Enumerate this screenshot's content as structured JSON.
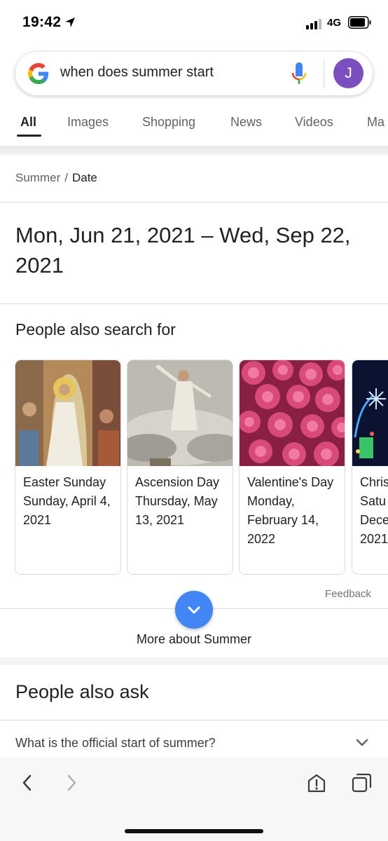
{
  "status_bar": {
    "time": "19:42",
    "network": "4G"
  },
  "search": {
    "query": "when does summer start",
    "avatar_letter": "J"
  },
  "tabs": [
    {
      "label": "All"
    },
    {
      "label": "Images"
    },
    {
      "label": "Shopping"
    },
    {
      "label": "News"
    },
    {
      "label": "Videos"
    },
    {
      "label": "Ma"
    }
  ],
  "breadcrumb": {
    "parent": "Summer",
    "separator": "/",
    "current": "Date"
  },
  "answer": {
    "text": "Mon, Jun 21, 2021 – Wed, Sep 22, 2021"
  },
  "people_also_search": {
    "title": "People also search for",
    "cards": [
      {
        "name": "Easter Sunday",
        "date": "Sunday, April 4, 2021"
      },
      {
        "name": "Ascension Day",
        "date": "Thursday, May 13, 2021"
      },
      {
        "name": "Valentine's Day",
        "date": "Monday, February 14, 2022"
      },
      {
        "name": "Chris",
        "date": "Satu Dece 2021"
      }
    ]
  },
  "feedback": "Feedback",
  "more_about": "More about Summer",
  "people_also_ask": {
    "title": "People also ask",
    "questions": [
      {
        "text": "What is the official start of summer?"
      }
    ]
  },
  "colors": {
    "accent": "#4285f4",
    "avatar": "#7b4fbd"
  }
}
